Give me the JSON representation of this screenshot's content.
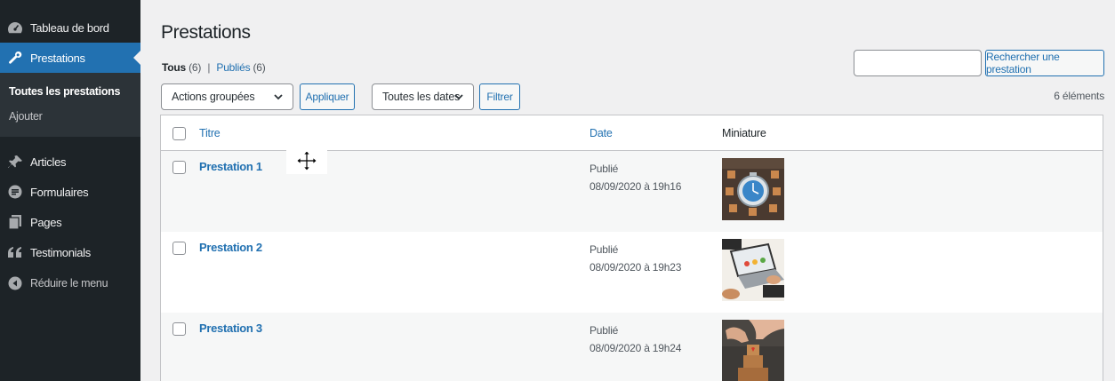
{
  "sidebar": {
    "items": [
      {
        "label": "Tableau de bord",
        "icon": "dashboard-icon"
      },
      {
        "label": "Prestations",
        "icon": "wrench-icon"
      },
      {
        "label": "Articles",
        "icon": "pushpin-icon"
      },
      {
        "label": "Formulaires",
        "icon": "forms-icon"
      },
      {
        "label": "Pages",
        "icon": "pages-icon"
      },
      {
        "label": "Testimonials",
        "icon": "quote-icon"
      },
      {
        "label": "Réduire le menu",
        "icon": "collapse-icon"
      }
    ],
    "submenu": {
      "current": "Toutes les prestations",
      "add": "Ajouter"
    }
  },
  "page": {
    "title": "Prestations",
    "filters": {
      "all_label": "Tous",
      "all_count": "(6)",
      "separator": "|",
      "published_label": "Publiés",
      "published_count": "(6)"
    },
    "search_button": "Rechercher une prestation",
    "bulk_select": "Actions groupées",
    "apply_button": "Appliquer",
    "dates_select": "Toutes les dates",
    "filter_button": "Filtrer",
    "items_count": "6 éléments"
  },
  "table": {
    "headers": {
      "title": "Titre",
      "date": "Date",
      "thumbnail": "Miniature"
    },
    "rows": [
      {
        "title": "Prestation 1",
        "status": "Publié",
        "date": "08/09/2020 à 19h16",
        "thumbnail": "clock-image"
      },
      {
        "title": "Prestation 2",
        "status": "Publié",
        "date": "08/09/2020 à 19h23",
        "thumbnail": "laptop-marketing-image"
      },
      {
        "title": "Prestation 3",
        "status": "Publié",
        "date": "08/09/2020 à 19h24",
        "thumbnail": "blocks-hand-image"
      }
    ]
  },
  "colors": {
    "sidebar_bg": "#1d2327",
    "accent": "#2271b1",
    "page_bg": "#f0f0f1"
  }
}
